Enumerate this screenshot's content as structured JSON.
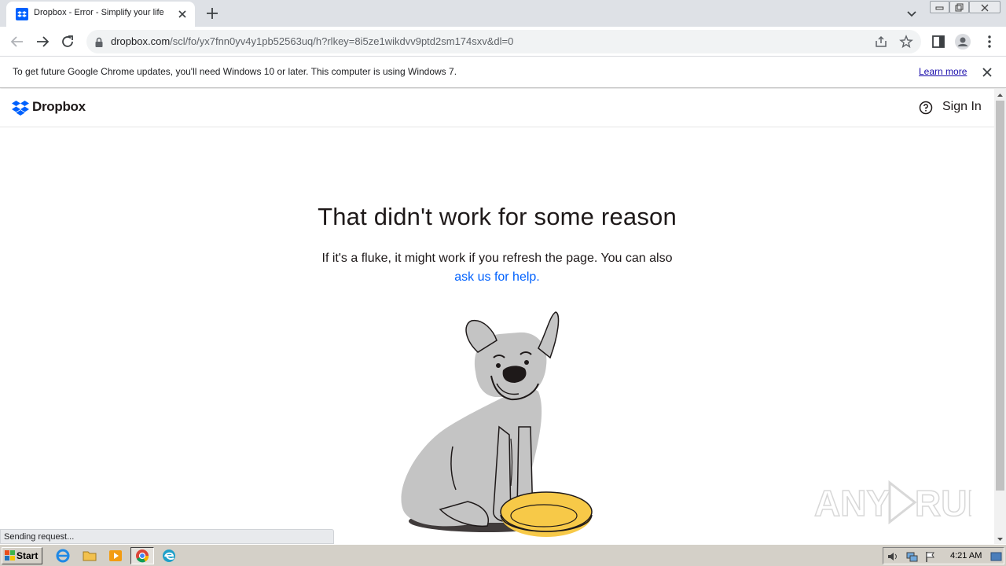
{
  "browser": {
    "tab": {
      "title": "Dropbox - Error - Simplify your life",
      "favicon": "dropbox-icon"
    },
    "address_bar": {
      "host": "dropbox.com",
      "path": "/scl/fo/yx7fnn0yv4y1pb52563uq/h?rlkey=8i5ze1wikdvv9ptd2sm174sxv&dl=0"
    },
    "infobar": {
      "message": "To get future Google Chrome updates, you'll need Windows 10 or later. This computer is using Windows 7.",
      "link": "Learn more"
    },
    "status_text": "Sending request..."
  },
  "header": {
    "brand": "Dropbox",
    "sign_in": "Sign In"
  },
  "error": {
    "title": "That didn't work for some reason",
    "body": "If it's a fluke, it might work if you refresh the page. You can also",
    "help_link": "ask us for help."
  },
  "taskbar": {
    "start_label": "Start",
    "clock": "4:21 AM"
  },
  "colors": {
    "dropbox_blue": "#0061fe",
    "link_blue": "#0061fe",
    "dog_gray": "#c4c4c4",
    "bowl_yellow": "#f7c948"
  }
}
